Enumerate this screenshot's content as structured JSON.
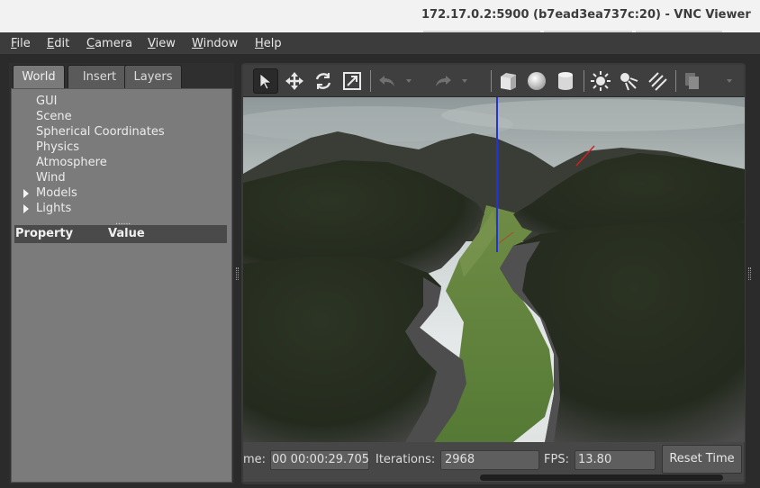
{
  "window": {
    "title": "172.17.0.2:5900 (b7ead3ea737c:20) - VNC Viewer"
  },
  "menu": [
    {
      "mnemonic": "F",
      "rest": "ile"
    },
    {
      "mnemonic": "E",
      "rest": "dit"
    },
    {
      "mnemonic": "C",
      "rest": "amera"
    },
    {
      "mnemonic": "V",
      "rest": "iew"
    },
    {
      "mnemonic": "W",
      "rest": "indow"
    },
    {
      "mnemonic": "H",
      "rest": "elp"
    }
  ],
  "left_panel": {
    "tabs": [
      "World",
      "Insert",
      "Layers"
    ],
    "active_tab": "World",
    "tree": [
      "GUI",
      "Scene",
      "Spherical Coordinates",
      "Physics",
      "Atmosphere",
      "Wind",
      "Models",
      "Lights"
    ],
    "splitter_handle": "......",
    "property_header": {
      "property": "Property",
      "value": "Value"
    }
  },
  "toolbar": {
    "icons": [
      "select-arrow-icon",
      "translate-icon",
      "rotate-icon",
      "scale-icon",
      "undo-icon",
      "undo-dropdown-icon",
      "redo-icon",
      "redo-dropdown-icon",
      "box-icon",
      "sphere-icon",
      "cylinder-icon",
      "point-light-icon",
      "spot-light-icon",
      "directional-light-icon",
      "copy-icon",
      "paste-icon"
    ]
  },
  "status": {
    "time_label": "me:",
    "time_value": "00 00:00:29.705",
    "iterations_label": "Iterations:",
    "iterations_value": "2968",
    "fps_label": "FPS:",
    "fps_value": "13.80",
    "reset_button": "Reset Time"
  },
  "colors": {
    "menubar_bg": "#3c3c3c",
    "panel_bg": "#7b7b7b",
    "terrain_dark": "#252c20",
    "grass": "#5e7a3c",
    "axis_z": "#2233dd",
    "axis_x": "#d02020"
  }
}
